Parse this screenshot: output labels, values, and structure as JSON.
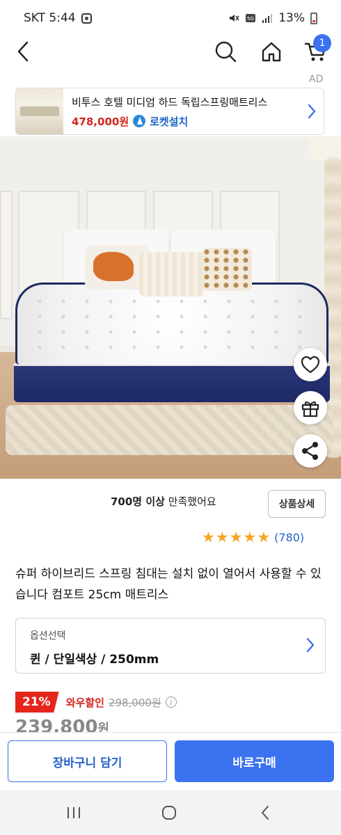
{
  "status_bar": {
    "carrier_time": "SKT 5:44",
    "battery": "13%",
    "icons": [
      "instagram-icon",
      "mute-icon",
      "5g-icon",
      "signal-icon",
      "battery-icon"
    ]
  },
  "nav": {
    "icons": [
      "back-icon",
      "search-icon",
      "home-icon",
      "cart-icon"
    ],
    "cart_count": "1"
  },
  "ad": {
    "label": "AD",
    "title": "비투스 호텔 미디엄 하드 독립스프링매트리스",
    "price": "478,000원",
    "shipping": "로켓설치"
  },
  "product_image": {
    "floating_icons": [
      "heart-icon",
      "gift-icon",
      "share-icon"
    ]
  },
  "satisfaction": {
    "count": "700명 이상",
    "text": " 만족했어요",
    "detail_button": "상품상세"
  },
  "rating": {
    "stars": 5,
    "count": "(780)"
  },
  "product_title": "슈퍼 하이브리드 스프링 침대는 설치 없이 열어서 사용할 수 있습니다 컴포트 25cm 매트리스",
  "option": {
    "label": "옵션선택",
    "value": "퀸 / 단일색상 / 250mm"
  },
  "price": {
    "discount": "21%",
    "deal_label": "와우할인",
    "original": "298,000원",
    "final": "239,800",
    "final_unit": "원"
  },
  "actions": {
    "add_to_cart": "장바구니 담기",
    "buy_now": "바로구매"
  },
  "system_nav": [
    "recent-apps-icon",
    "home-circle-icon",
    "system-back-icon"
  ],
  "colors": {
    "accent_blue": "#3a72f0",
    "sale_red": "#e5261c",
    "star_gold": "#f5a623"
  }
}
